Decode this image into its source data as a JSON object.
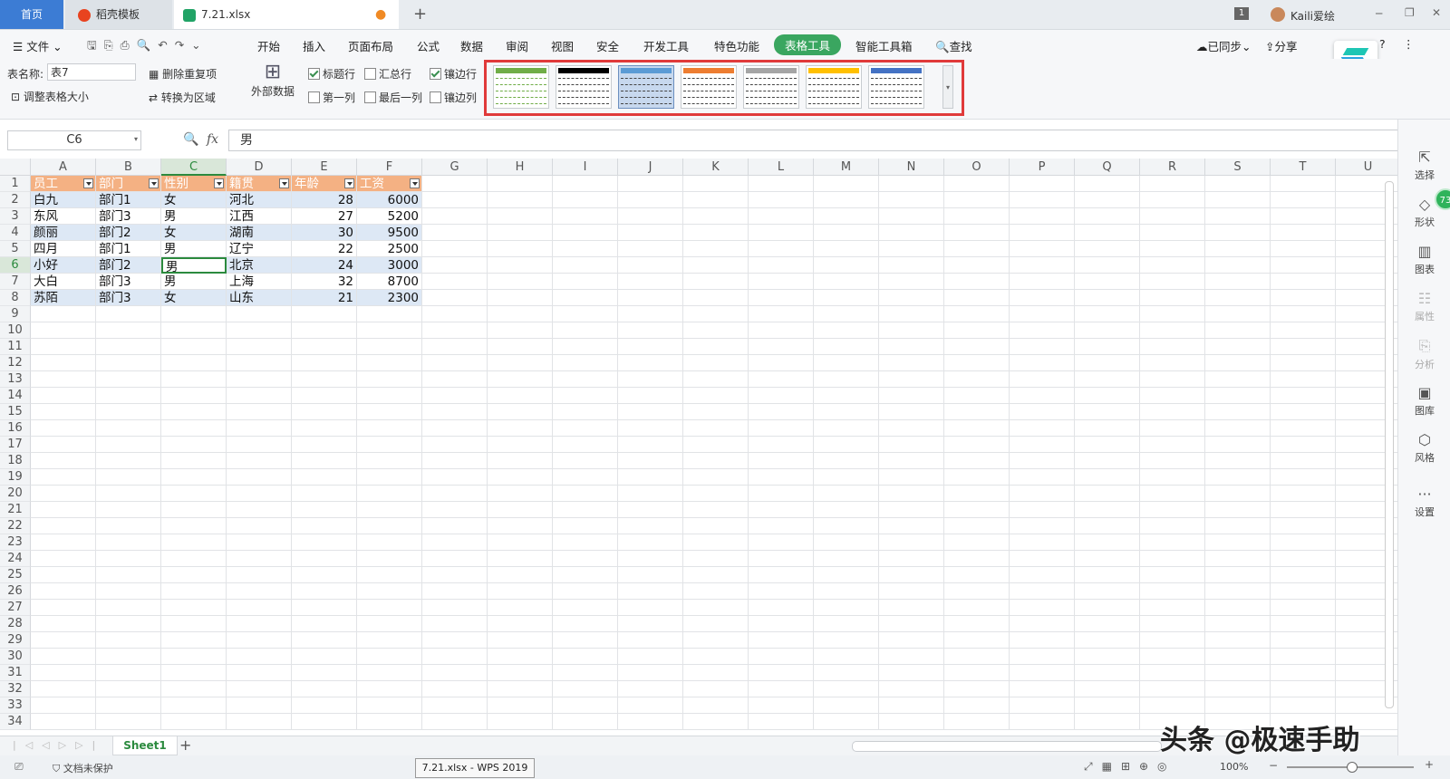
{
  "title_tabs": {
    "home": "首页",
    "docer": "稻壳模板",
    "file": "7.21.xlsx",
    "add": "+"
  },
  "titlebar_right": {
    "badge": "1",
    "user": "Kaili爱绘",
    "minimize": "─",
    "restore": "❐",
    "close": "✕"
  },
  "menu": {
    "file": "文件",
    "items": [
      "开始",
      "插入",
      "页面布局",
      "公式",
      "数据",
      "审阅",
      "视图",
      "安全",
      "开发工具",
      "特色功能",
      "表格工具",
      "智能工具箱"
    ],
    "search": "查找",
    "sync": "已同步",
    "share": "分享",
    "more": "⋮",
    "help": "?"
  },
  "ribbon": {
    "table_name_label": "表名称:",
    "table_name_value": "表7",
    "resize_table": "调整表格大小",
    "remove_duplicates": "删除重复项",
    "convert_to_range": "转换为区域",
    "external_data": "外部数据",
    "opt_header_row": "标题行",
    "opt_total_row": "汇总行",
    "opt_banded_rows": "镶边行",
    "opt_first_col": "第一列",
    "opt_last_col": "最后一列",
    "opt_banded_cols": "镶边列",
    "header_row_checked": true,
    "banded_rows_checked": true,
    "style_colors": [
      "#70ad47",
      "#000000",
      "#5b9bd5",
      "#ed7d31",
      "#a5a5a5",
      "#ffc000",
      "#4472c4"
    ]
  },
  "formula_bar": {
    "name_box": "C6",
    "fx": "fx",
    "value": "男"
  },
  "columns": [
    "A",
    "B",
    "C",
    "D",
    "E",
    "F",
    "G",
    "H",
    "I",
    "J",
    "K",
    "L",
    "M",
    "N",
    "O",
    "P",
    "Q",
    "R",
    "S",
    "T",
    "U"
  ],
  "row_numbers": [
    "1",
    "2",
    "3",
    "4",
    "5",
    "6",
    "7",
    "8",
    "9",
    "10",
    "11",
    "12",
    "13",
    "14",
    "15",
    "16",
    "17",
    "18",
    "19",
    "20",
    "21",
    "22",
    "23",
    "24",
    "25",
    "26",
    "27",
    "28",
    "29",
    "30",
    "31",
    "32",
    "33",
    "34"
  ],
  "table": {
    "headers": [
      "员工",
      "部门",
      "性别",
      "籍贯",
      "年龄",
      "工资"
    ],
    "rows": [
      [
        "白九",
        "部门1",
        "女",
        "河北",
        "28",
        "6000"
      ],
      [
        "东风",
        "部门3",
        "男",
        "江西",
        "27",
        "5200"
      ],
      [
        "颜丽",
        "部门2",
        "女",
        "湖南",
        "30",
        "9500"
      ],
      [
        "四月",
        "部门1",
        "男",
        "辽宁",
        "22",
        "2500"
      ],
      [
        "小好",
        "部门2",
        "男",
        "北京",
        "24",
        "3000"
      ],
      [
        "大白",
        "部门3",
        "男",
        "上海",
        "32",
        "8700"
      ],
      [
        "苏陌",
        "部门3",
        "女",
        "山东",
        "21",
        "2300"
      ]
    ],
    "header_color": "#f4b183",
    "band_color": "#dde8f5"
  },
  "sheet_tabs": {
    "active": "Sheet1",
    "add": "+"
  },
  "status": {
    "protect": "文档未保护",
    "taskbar": "7.21.xlsx - WPS 2019",
    "zoom": "100%"
  },
  "right_panel": {
    "items": [
      "选择",
      "形状",
      "图表",
      "属性",
      "分析",
      "图库",
      "风格",
      "设置"
    ],
    "badge": "73"
  },
  "watermark": "头条 @极速手助"
}
